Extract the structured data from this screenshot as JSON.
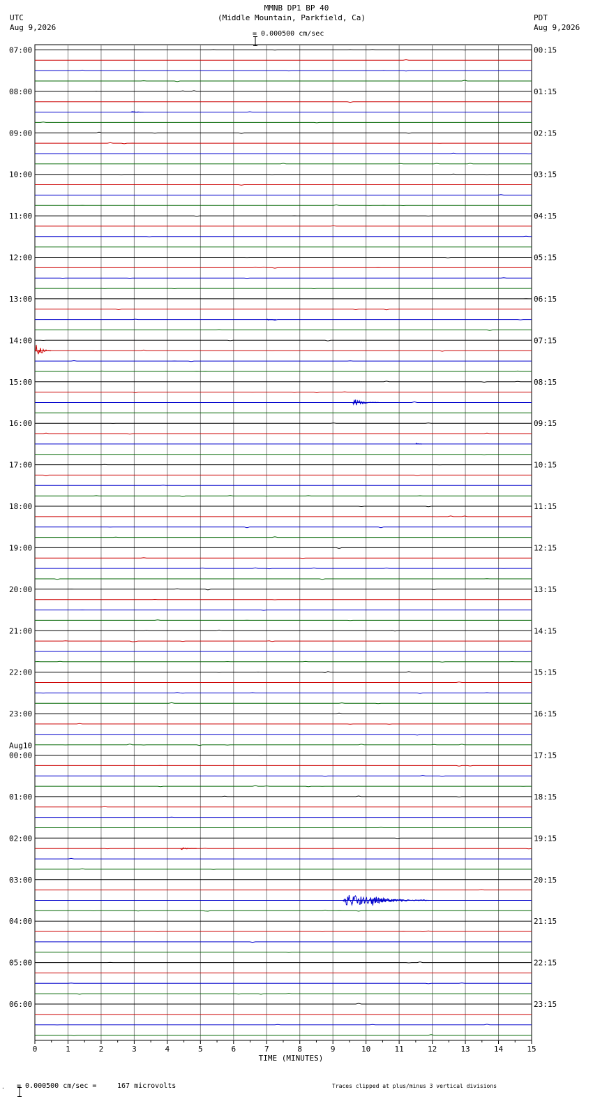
{
  "header": {
    "station": "MMNB DP1 BP 40",
    "location": "(Middle Mountain, Parkfield, Ca)",
    "scale_text": "= 0.000500 cm/sec",
    "left_tz": "UTC",
    "left_date": "Aug 9,2026",
    "right_tz": "PDT",
    "right_date": "Aug 9,2026"
  },
  "footer": {
    "scale_text": "= 0.000500 cm/sec =",
    "microvolts": "167 microvolts",
    "clip_note": "Traces clipped at plus/minus 3 vertical divisions"
  },
  "colors": {
    "trace_cycle": [
      "#000000",
      "#cc0000",
      "#0000cc",
      "#006600"
    ],
    "grid": "#808080"
  },
  "chart_data": {
    "type": "line",
    "xlabel": "TIME (MINUTES)",
    "xlim": [
      0,
      15
    ],
    "x_ticks": [
      "0",
      "1",
      "2",
      "3",
      "4",
      "5",
      "6",
      "7",
      "8",
      "9",
      "10",
      "11",
      "12",
      "13",
      "14",
      "15"
    ],
    "traces_per_hour": 4,
    "hour_count": 24,
    "left_labels": [
      "07:00",
      "08:00",
      "09:00",
      "10:00",
      "11:00",
      "12:00",
      "13:00",
      "14:00",
      "15:00",
      "16:00",
      "17:00",
      "18:00",
      "19:00",
      "20:00",
      "21:00",
      "22:00",
      "23:00",
      "Aug10\n00:00",
      "01:00",
      "02:00",
      "03:00",
      "04:00",
      "05:00",
      "06:00"
    ],
    "right_labels": [
      "00:15",
      "01:15",
      "02:15",
      "03:15",
      "04:15",
      "05:15",
      "06:15",
      "07:15",
      "08:15",
      "09:15",
      "10:15",
      "11:15",
      "12:15",
      "13:15",
      "14:15",
      "15:15",
      "16:15",
      "17:15",
      "18:15",
      "19:15",
      "20:15",
      "21:15",
      "22:15",
      "23:15"
    ],
    "events": [
      {
        "trace": 6,
        "start_min": 2.9,
        "duration_min": 0.4,
        "amp": 2
      },
      {
        "trace": 26,
        "start_min": 7.0,
        "duration_min": 0.3,
        "amp": 1.5
      },
      {
        "trace": 29,
        "start_min": 0.0,
        "duration_min": 0.5,
        "amp": 12
      },
      {
        "trace": 34,
        "start_min": 9.6,
        "duration_min": 0.8,
        "amp": 6
      },
      {
        "trace": 38,
        "start_min": 11.5,
        "duration_min": 0.2,
        "amp": 2
      },
      {
        "trace": 77,
        "start_min": 4.4,
        "duration_min": 0.5,
        "amp": 2
      },
      {
        "trace": 82,
        "start_min": 9.3,
        "duration_min": 2.6,
        "amp": 11
      },
      {
        "trace": 82,
        "start_min": 10.1,
        "duration_min": 1.2,
        "amp": 10
      }
    ]
  }
}
